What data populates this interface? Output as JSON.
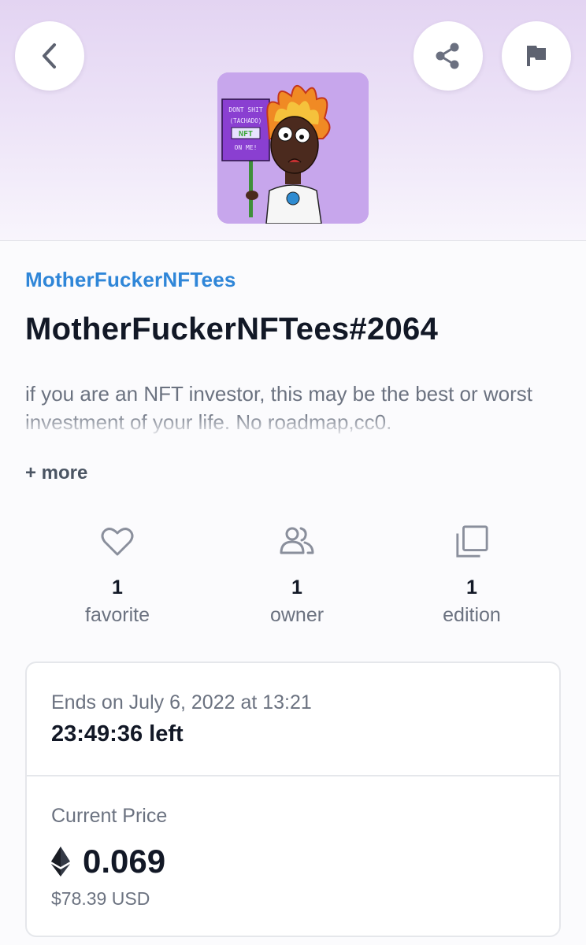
{
  "header": {
    "back_icon": "chevron-left-icon",
    "share_icon": "share-icon",
    "flag_icon": "flag-icon"
  },
  "nft": {
    "image_sign_lines": [
      "DONT SHIT",
      "(TACHADO)",
      "NFT",
      "ON ME!"
    ],
    "collection": "MotherFuckerNFTees",
    "title": "MotherFuckerNFTees#2064",
    "description": "if you are an NFT investor, this may be the best or worst investment of your life. No roadmap,cc0.",
    "more_label": "+ more"
  },
  "stats": {
    "favorites": {
      "count": "1",
      "label": "favorite",
      "icon": "heart-icon"
    },
    "owners": {
      "count": "1",
      "label": "owner",
      "icon": "users-icon"
    },
    "editions": {
      "count": "1",
      "label": "edition",
      "icon": "copies-icon"
    }
  },
  "auction": {
    "ends_label": "Ends on July 6, 2022 at 13:21",
    "time_left": "23:49:36 left",
    "price_label": "Current Price",
    "price_eth": "0.069",
    "price_usd": "$78.39 USD",
    "currency_icon": "ethereum-icon"
  },
  "colors": {
    "accent": "#2f86d8",
    "hero_gradient_top": "#e3d4f2",
    "text_primary": "#121826",
    "text_secondary": "#6b7280"
  }
}
